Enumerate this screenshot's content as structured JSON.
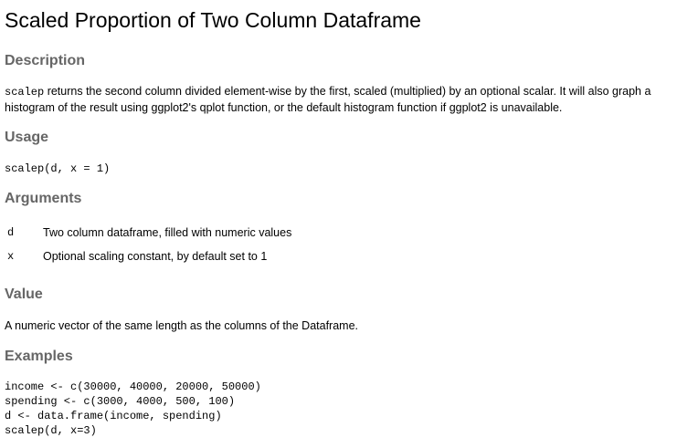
{
  "title": "Scaled Proportion of Two Column Dataframe",
  "description": {
    "heading": "Description",
    "code_term": "scalep",
    "line1_rest": " returns the second column divided element-wise by the first, scaled (multiplied) by an optional scalar. It will also graph a",
    "line2": "histogram of the result using ggplot2's qplot function, or the default histogram function if ggplot2 is unavailable."
  },
  "usage": {
    "heading": "Usage",
    "code": "scalep(d, x = 1)"
  },
  "arguments": {
    "heading": "Arguments",
    "items": [
      {
        "name": "d",
        "desc": "Two column dataframe, filled with numeric values"
      },
      {
        "name": "x",
        "desc": "Optional scaling constant, by default set to 1"
      }
    ]
  },
  "value": {
    "heading": "Value",
    "text": "A numeric vector of the same length as the columns of the Dataframe."
  },
  "examples": {
    "heading": "Examples",
    "code": "income <- c(30000, 40000, 20000, 50000)\nspending <- c(3000, 4000, 500, 100)\nd <- data.frame(income, spending)\nscalep(d, x=3)"
  }
}
